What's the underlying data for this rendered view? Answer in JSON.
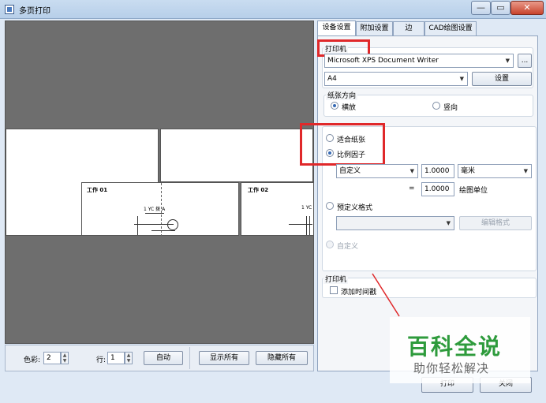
{
  "window": {
    "title": "多页打印",
    "min": "—",
    "max": "▭",
    "close": "✕"
  },
  "preview": {
    "sheet1_title": "工作 01",
    "sheet2_title": "工作 02",
    "sheet1_note": "1 YC 拨 A",
    "sheet2_note": "1 YC"
  },
  "toolbar": {
    "color_label": "色彩:",
    "color_value": "2",
    "row_label": "行:",
    "row_value": "1",
    "auto_button": "自动",
    "show_all_button": "显示所有",
    "hide_all_button": "隐藏所有"
  },
  "tabs": [
    "设备设置",
    "附加设置",
    "边",
    "CAD绘图设置"
  ],
  "printer": {
    "group_title": "打印机",
    "printer_name": "Microsoft XPS Document Writer",
    "browse_button": "...",
    "paper_size": "A4",
    "setup_button": "设置"
  },
  "orientation": {
    "group_title": "纸张方向",
    "landscape": "横放",
    "portrait": "竖向",
    "selected": "landscape"
  },
  "scale": {
    "fit_paper": "适合纸张",
    "scale_factor": "比例因子",
    "mode": "自定义",
    "value1": "1.0000",
    "unit": "毫米",
    "equals": "=",
    "value2": "1.0000",
    "drawing_unit": "绘图单位",
    "predefined": "预定义格式",
    "predefined_combo": "",
    "edit_format_button": "编辑格式",
    "custom": "自定义",
    "selected": "scale_factor"
  },
  "timestamp": {
    "group_title": "打印机",
    "add_timestamp": "添加时间戳"
  },
  "dialog": {
    "print_button": "打印",
    "close_button": "关闭"
  },
  "watermark": {
    "main": "百科全说",
    "sub": "助你轻松解决"
  },
  "colors": {
    "highlight": "#e0282a",
    "watermark_green": "#2e9b3c"
  }
}
